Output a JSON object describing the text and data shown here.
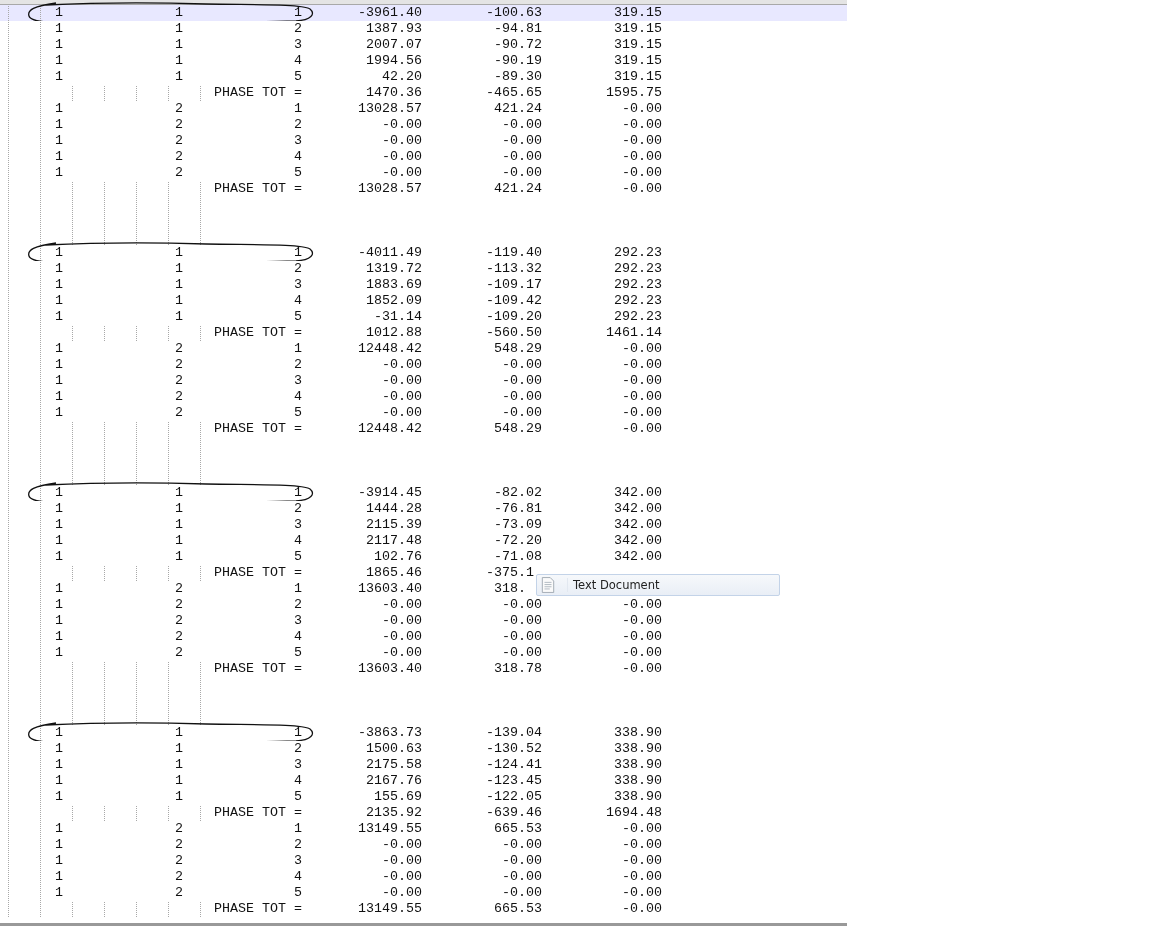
{
  "blocks": [
    {
      "circled": true,
      "rows": [
        {
          "kind": "data",
          "cells": [
            "1",
            "1",
            "1"
          ],
          "values": [
            "-3961.40",
            "-100.63",
            "319.15"
          ],
          "current_line": true
        },
        {
          "kind": "data",
          "cells": [
            "1",
            "1",
            "2"
          ],
          "values": [
            "1387.93",
            "-94.81",
            "319.15"
          ],
          "current_line": false
        },
        {
          "kind": "data",
          "cells": [
            "1",
            "1",
            "3"
          ],
          "values": [
            "2007.07",
            "-90.72",
            "319.15"
          ],
          "current_line": false
        },
        {
          "kind": "data",
          "cells": [
            "1",
            "1",
            "4"
          ],
          "values": [
            "1994.56",
            "-90.19",
            "319.15"
          ],
          "current_line": false
        },
        {
          "kind": "data",
          "cells": [
            "1",
            "1",
            "5"
          ],
          "values": [
            "42.20",
            "-89.30",
            "319.15"
          ],
          "current_line": false
        },
        {
          "kind": "total",
          "label": "PHASE TOT =",
          "values": [
            "1470.36",
            "-465.65",
            "1595.75"
          ],
          "current_line": false
        },
        {
          "kind": "data",
          "cells": [
            "1",
            "2",
            "1"
          ],
          "values": [
            "13028.57",
            "421.24",
            "-0.00"
          ],
          "current_line": false
        },
        {
          "kind": "data",
          "cells": [
            "1",
            "2",
            "2"
          ],
          "values": [
            "-0.00",
            "-0.00",
            "-0.00"
          ],
          "current_line": false
        },
        {
          "kind": "data",
          "cells": [
            "1",
            "2",
            "3"
          ],
          "values": [
            "-0.00",
            "-0.00",
            "-0.00"
          ],
          "current_line": false
        },
        {
          "kind": "data",
          "cells": [
            "1",
            "2",
            "4"
          ],
          "values": [
            "-0.00",
            "-0.00",
            "-0.00"
          ],
          "current_line": false
        },
        {
          "kind": "data",
          "cells": [
            "1",
            "2",
            "5"
          ],
          "values": [
            "-0.00",
            "-0.00",
            "-0.00"
          ],
          "current_line": false
        },
        {
          "kind": "total",
          "label": "PHASE TOT =",
          "values": [
            "13028.57",
            "421.24",
            "-0.00"
          ],
          "current_line": false
        }
      ]
    },
    {
      "circled": true,
      "rows": [
        {
          "kind": "data",
          "cells": [
            "1",
            "1",
            "1"
          ],
          "values": [
            "-4011.49",
            "-119.40",
            "292.23"
          ],
          "current_line": false
        },
        {
          "kind": "data",
          "cells": [
            "1",
            "1",
            "2"
          ],
          "values": [
            "1319.72",
            "-113.32",
            "292.23"
          ],
          "current_line": false
        },
        {
          "kind": "data",
          "cells": [
            "1",
            "1",
            "3"
          ],
          "values": [
            "1883.69",
            "-109.17",
            "292.23"
          ],
          "current_line": false
        },
        {
          "kind": "data",
          "cells": [
            "1",
            "1",
            "4"
          ],
          "values": [
            "1852.09",
            "-109.42",
            "292.23"
          ],
          "current_line": false
        },
        {
          "kind": "data",
          "cells": [
            "1",
            "1",
            "5"
          ],
          "values": [
            "-31.14",
            "-109.20",
            "292.23"
          ],
          "current_line": false
        },
        {
          "kind": "total",
          "label": "PHASE TOT =",
          "values": [
            "1012.88",
            "-560.50",
            "1461.14"
          ],
          "current_line": false
        },
        {
          "kind": "data",
          "cells": [
            "1",
            "2",
            "1"
          ],
          "values": [
            "12448.42",
            "548.29",
            "-0.00"
          ],
          "current_line": false
        },
        {
          "kind": "data",
          "cells": [
            "1",
            "2",
            "2"
          ],
          "values": [
            "-0.00",
            "-0.00",
            "-0.00"
          ],
          "current_line": false
        },
        {
          "kind": "data",
          "cells": [
            "1",
            "2",
            "3"
          ],
          "values": [
            "-0.00",
            "-0.00",
            "-0.00"
          ],
          "current_line": false
        },
        {
          "kind": "data",
          "cells": [
            "1",
            "2",
            "4"
          ],
          "values": [
            "-0.00",
            "-0.00",
            "-0.00"
          ],
          "current_line": false
        },
        {
          "kind": "data",
          "cells": [
            "1",
            "2",
            "5"
          ],
          "values": [
            "-0.00",
            "-0.00",
            "-0.00"
          ],
          "current_line": false
        },
        {
          "kind": "total",
          "label": "PHASE TOT =",
          "values": [
            "12448.42",
            "548.29",
            "-0.00"
          ],
          "current_line": false
        }
      ]
    },
    {
      "circled": true,
      "rows": [
        {
          "kind": "data",
          "cells": [
            "1",
            "1",
            "1"
          ],
          "values": [
            "-3914.45",
            "-82.02",
            "342.00"
          ],
          "current_line": false
        },
        {
          "kind": "data",
          "cells": [
            "1",
            "1",
            "2"
          ],
          "values": [
            "1444.28",
            "-76.81",
            "342.00"
          ],
          "current_line": false
        },
        {
          "kind": "data",
          "cells": [
            "1",
            "1",
            "3"
          ],
          "values": [
            "2115.39",
            "-73.09",
            "342.00"
          ],
          "current_line": false
        },
        {
          "kind": "data",
          "cells": [
            "1",
            "1",
            "4"
          ],
          "values": [
            "2117.48",
            "-72.20",
            "342.00"
          ],
          "current_line": false
        },
        {
          "kind": "data",
          "cells": [
            "1",
            "1",
            "5"
          ],
          "values": [
            "102.76",
            "-71.08",
            "342.00"
          ],
          "current_line": false
        },
        {
          "kind": "total",
          "label": "PHASE TOT =",
          "values": [
            "1865.46",
            "-375.1"
          ],
          "current_line": false
        },
        {
          "kind": "data",
          "cells": [
            "1",
            "2",
            "1"
          ],
          "values": [
            "13603.40",
            "318."
          ],
          "current_line": false
        },
        {
          "kind": "data",
          "cells": [
            "1",
            "2",
            "2"
          ],
          "values": [
            "-0.00",
            "-0.00",
            "-0.00"
          ],
          "current_line": false
        },
        {
          "kind": "data",
          "cells": [
            "1",
            "2",
            "3"
          ],
          "values": [
            "-0.00",
            "-0.00",
            "-0.00"
          ],
          "current_line": false
        },
        {
          "kind": "data",
          "cells": [
            "1",
            "2",
            "4"
          ],
          "values": [
            "-0.00",
            "-0.00",
            "-0.00"
          ],
          "current_line": false
        },
        {
          "kind": "data",
          "cells": [
            "1",
            "2",
            "5"
          ],
          "values": [
            "-0.00",
            "-0.00",
            "-0.00"
          ],
          "current_line": false
        },
        {
          "kind": "total",
          "label": "PHASE TOT =",
          "values": [
            "13603.40",
            "318.78",
            "-0.00"
          ],
          "current_line": false
        }
      ]
    },
    {
      "circled": true,
      "rows": [
        {
          "kind": "data",
          "cells": [
            "1",
            "1",
            "1"
          ],
          "values": [
            "-3863.73",
            "-139.04",
            "338.90"
          ],
          "current_line": false
        },
        {
          "kind": "data",
          "cells": [
            "1",
            "1",
            "2"
          ],
          "values": [
            "1500.63",
            "-130.52",
            "338.90"
          ],
          "current_line": false
        },
        {
          "kind": "data",
          "cells": [
            "1",
            "1",
            "3"
          ],
          "values": [
            "2175.58",
            "-124.41",
            "338.90"
          ],
          "current_line": false
        },
        {
          "kind": "data",
          "cells": [
            "1",
            "1",
            "4"
          ],
          "values": [
            "2167.76",
            "-123.45",
            "338.90"
          ],
          "current_line": false
        },
        {
          "kind": "data",
          "cells": [
            "1",
            "1",
            "5"
          ],
          "values": [
            "155.69",
            "-122.05",
            "338.90"
          ],
          "current_line": false
        },
        {
          "kind": "total",
          "label": "PHASE TOT =",
          "values": [
            "2135.92",
            "-639.46",
            "1694.48"
          ],
          "current_line": false
        },
        {
          "kind": "data",
          "cells": [
            "1",
            "2",
            "1"
          ],
          "values": [
            "13149.55",
            "665.53",
            "-0.00"
          ],
          "current_line": false
        },
        {
          "kind": "data",
          "cells": [
            "1",
            "2",
            "2"
          ],
          "values": [
            "-0.00",
            "-0.00",
            "-0.00"
          ],
          "current_line": false
        },
        {
          "kind": "data",
          "cells": [
            "1",
            "2",
            "3"
          ],
          "values": [
            "-0.00",
            "-0.00",
            "-0.00"
          ],
          "current_line": false
        },
        {
          "kind": "data",
          "cells": [
            "1",
            "2",
            "4"
          ],
          "values": [
            "-0.00",
            "-0.00",
            "-0.00"
          ],
          "current_line": false
        },
        {
          "kind": "data",
          "cells": [
            "1",
            "2",
            "5"
          ],
          "values": [
            "-0.00",
            "-0.00",
            "-0.00"
          ],
          "current_line": false
        },
        {
          "kind": "total",
          "label": "PHASE TOT =",
          "values": [
            "13149.55",
            "665.53",
            "-0.00"
          ],
          "current_line": false
        }
      ]
    }
  ],
  "tooltip": {
    "text": "Text Document"
  }
}
